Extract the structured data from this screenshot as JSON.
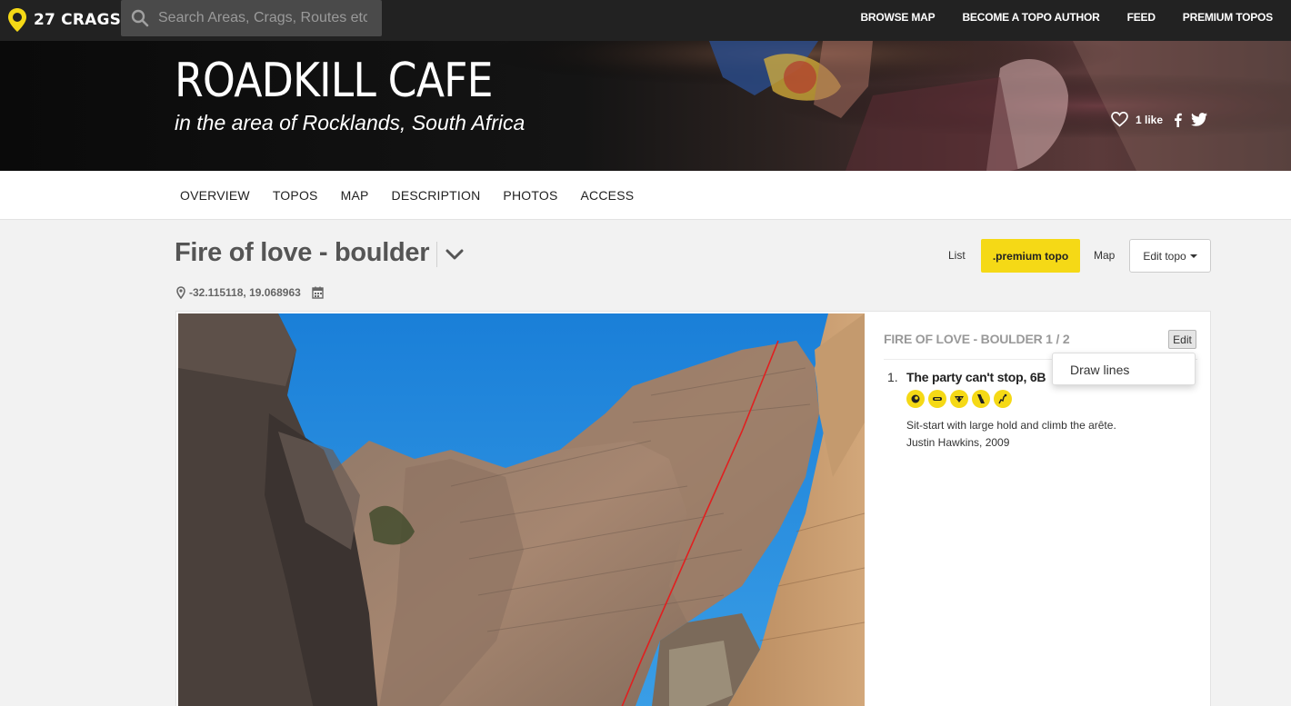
{
  "app": {
    "logo_text": "27 CRAGS",
    "search_placeholder": "Search Areas, Crags, Routes etc."
  },
  "nav": {
    "items": [
      {
        "label": "BROWSE MAP"
      },
      {
        "label": "BECOME A TOPO AUTHOR"
      },
      {
        "label": "FEED"
      },
      {
        "label": "PREMIUM TOPOS"
      }
    ]
  },
  "hero": {
    "title": "ROADKILL CAFE",
    "subtitle": "in the area of Rocklands, South Africa",
    "likes": "1 like",
    "social_icons": [
      "heart-icon",
      "facebook-icon",
      "twitter-icon"
    ]
  },
  "tabs": [
    {
      "label": "OVERVIEW"
    },
    {
      "label": "TOPOS"
    },
    {
      "label": "MAP"
    },
    {
      "label": "DESCRIPTION"
    },
    {
      "label": "PHOTOS"
    },
    {
      "label": "ACCESS"
    }
  ],
  "topo": {
    "title": "Fire of love - boulder",
    "view_list": "List",
    "premium_label": ".premium topo",
    "view_map": "Map",
    "edit_topo_label": "Edit topo",
    "coordinates": "-32.115118, 19.068963"
  },
  "panel": {
    "heading": "FIRE OF LOVE - BOULDER 1 / 2",
    "edit_label": "Edit",
    "dropdown_item": "Draw lines",
    "route": {
      "number": "1.",
      "name": "The party can't stop, 6B",
      "icons": [
        "sit-start-icon",
        "crimp-icon",
        "overhang-icon",
        "arete-icon",
        "highball-icon"
      ],
      "description": "Sit-start with large hold and climb the arête.",
      "author": "Justin Hawkins, 2009"
    }
  },
  "colors": {
    "brand_yellow": "#f5d916",
    "topbar": "#222222",
    "route_line": "#e02020"
  }
}
